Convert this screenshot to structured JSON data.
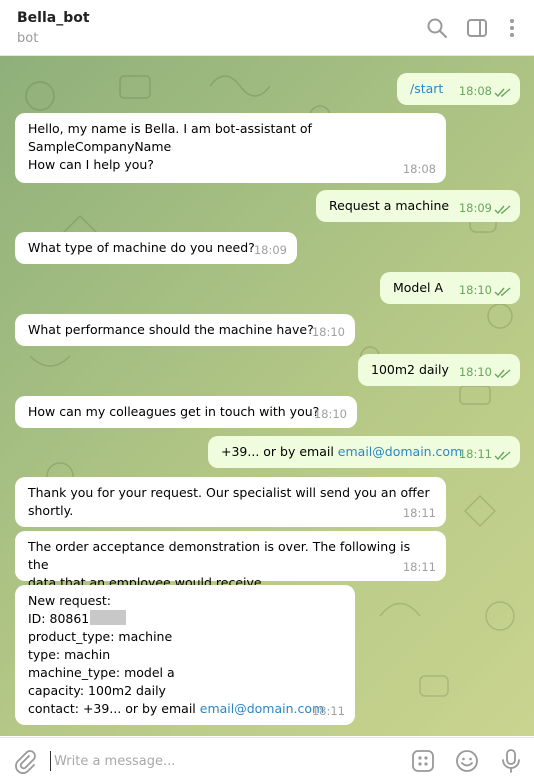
{
  "header": {
    "title": "Bella_bot",
    "subtitle": "bot",
    "icons": [
      "search-icon",
      "sidebar-toggle-icon",
      "more-vertical-icon"
    ]
  },
  "messages": [
    {
      "dir": "out",
      "lines": [
        "/start"
      ],
      "time": "18:08",
      "kind": "command"
    },
    {
      "dir": "in",
      "lines": [
        "Hello, my name is Bella. I am bot-assistant of",
        "SampleCompanyName",
        "How can I help you?"
      ],
      "time": "18:08"
    },
    {
      "dir": "out",
      "lines": [
        "Request a machine"
      ],
      "time": "18:09"
    },
    {
      "dir": "in",
      "lines": [
        "What type of machine do you need?"
      ],
      "time": "18:09"
    },
    {
      "dir": "out",
      "lines": [
        "Model A"
      ],
      "time": "18:10"
    },
    {
      "dir": "in",
      "lines": [
        "What performance should the machine have?"
      ],
      "time": "18:10"
    },
    {
      "dir": "out",
      "lines": [
        "100m2 daily"
      ],
      "time": "18:10"
    },
    {
      "dir": "in",
      "lines": [
        "How can my colleagues get in touch with you?"
      ],
      "time": "18:10"
    },
    {
      "dir": "out",
      "text": "+39... or by email ",
      "link": "email@domain.com",
      "time": "18:11"
    },
    {
      "dir": "in",
      "lines": [
        "Thank you for your request. Our specialist will send you an offer",
        "shortly."
      ],
      "time": "18:11"
    },
    {
      "dir": "in",
      "lines": [
        "The order acceptance demonstration is over. The following is the",
        "data that an employee would receive."
      ],
      "time": "18:11"
    },
    {
      "dir": "in",
      "lines": [
        "New request:",
        "ID: 80861",
        "product_type: machine",
        "type: machin",
        "machine_type: model a",
        "capacity: 100m2 daily"
      ],
      "last_text": "contact: +39... or by email ",
      "last_link": "email@domain.com",
      "time": "18:11"
    }
  ],
  "composer": {
    "placeholder": "Write a message...",
    "icons": [
      "paperclip-icon",
      "bot-commands-icon",
      "emoji-icon",
      "microphone-icon"
    ]
  },
  "colors": {
    "incoming": "#ffffff",
    "outgoing": "#effdde",
    "link": "#2a87c5",
    "out_time": "#6aa660"
  }
}
